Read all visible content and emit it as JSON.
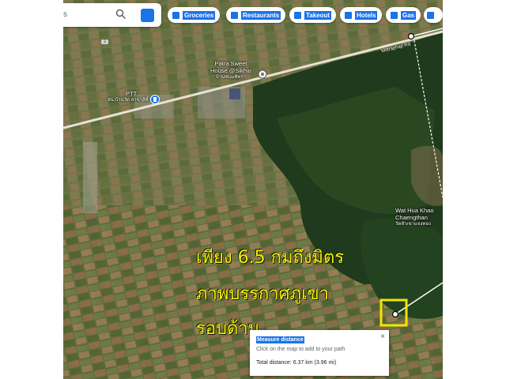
{
  "search": {
    "partial_text": "s"
  },
  "chips": [
    {
      "label": "Groceries"
    },
    {
      "label": "Restaurants"
    },
    {
      "label": "Takeout"
    },
    {
      "label": "Hotels"
    },
    {
      "label": "Gas"
    }
  ],
  "places": {
    "patra_title": "Patra Sweet",
    "patra_line2": "House @Sikhio",
    "patra_thai": "บ้านขนมพัทรา",
    "ptt_title": "PTT",
    "ptt_thai": "สน.บ้านวัด สาขาสีคิ้ว 2",
    "wat_title": "Wat Hua Khao",
    "wat_line2": "Chaengthan",
    "wat_thai": "วัดหัวเขาแจงทอง",
    "road_name": "Mittraphap Rd",
    "road_shield": "2"
  },
  "overlay": {
    "line1": "เพียง 6.5 กมถึงมิตร",
    "line2": "ภาพบรรกาศภูเขา",
    "line3": "รอบด้าน"
  },
  "measure": {
    "title": "Measure distance",
    "hint": "Click on the map to add to your path",
    "total": "Total distance: 6.37 km (3.96 mi)",
    "close": "×"
  },
  "colors": {
    "overlay_text": "#f2f20a",
    "highlight_box": "#f2e600",
    "accent": "#1a73e8"
  },
  "icons": [
    "search-icon",
    "directions-icon",
    "place-marker-icon",
    "fuel-marker-icon",
    "close-icon"
  ]
}
